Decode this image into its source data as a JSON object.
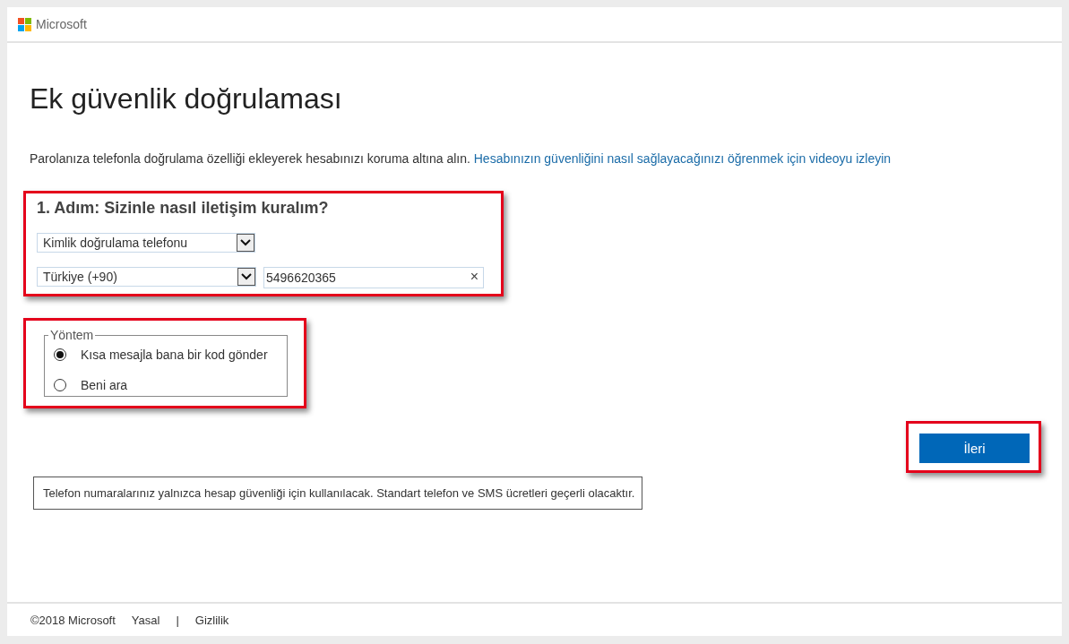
{
  "header": {
    "logo_text": "Microsoft"
  },
  "title": "Ek güvenlik doğrulaması",
  "intro": {
    "text": "Parolanıza telefonla doğrulama özelliği ekleyerek hesabınızı koruma altına alın.",
    "link": "Hesabınızın güvenliğini nasıl sağlayacağınızı öğrenmek için videoyu izleyin"
  },
  "step": {
    "heading": "1. Adım: Sizinle nasıl iletişim kuralım?",
    "contact_select": {
      "value": "Kimlik doğrulama telefonu"
    },
    "country_select": {
      "value": "Türkiye (+90)"
    },
    "phone_field": {
      "value": "5496620365",
      "clear": "×"
    }
  },
  "method": {
    "legend": "Yöntem",
    "options": [
      {
        "label": "Kısa mesajla bana bir kod gönder",
        "selected": true
      },
      {
        "label": "Beni ara",
        "selected": false
      }
    ]
  },
  "next_button": "İleri",
  "note": "Telefon numaralarınız yalnızca hesap güvenliği için kullanılacak. Standart telefon ve SMS ücretleri geçerli olacaktır.",
  "footer": {
    "copyright": "©2018 Microsoft",
    "links": [
      "Yasal",
      "Gizlilik"
    ],
    "separator": "|"
  }
}
